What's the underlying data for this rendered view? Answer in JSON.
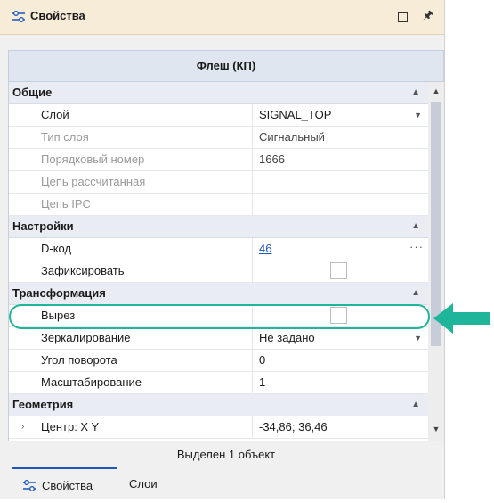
{
  "panel": {
    "title": "Свойства",
    "object_header": "Флеш (КП)",
    "status": "Выделен 1 объект"
  },
  "categories": [
    {
      "label": "Общие",
      "rows": [
        {
          "name": "Слой",
          "value": "SIGNAL_TOP",
          "kind": "dropdown",
          "disabled": false
        },
        {
          "name": "Тип слоя",
          "value": "Сигнальный",
          "kind": "text",
          "disabled": true
        },
        {
          "name": "Порядковый номер",
          "value": "1666",
          "kind": "text",
          "disabled": true
        },
        {
          "name": "Цепь рассчитанная",
          "value": "",
          "kind": "text",
          "disabled": true
        },
        {
          "name": "Цепь IPC",
          "value": "",
          "kind": "text",
          "disabled": true
        }
      ]
    },
    {
      "label": "Настройки",
      "rows": [
        {
          "name": "D-код",
          "value": "46",
          "kind": "link",
          "disabled": false
        },
        {
          "name": "Зафиксировать",
          "value": "",
          "kind": "checkbox",
          "checked": false,
          "disabled": false
        }
      ]
    },
    {
      "label": "Трансформация",
      "rows": [
        {
          "name": "Вырез",
          "value": "",
          "kind": "checkbox",
          "checked": false,
          "disabled": false,
          "highlighted": true
        },
        {
          "name": "Зеркалирование",
          "value": "Не задано",
          "kind": "dropdown",
          "disabled": false
        },
        {
          "name": "Угол поворота",
          "value": "0",
          "kind": "text",
          "disabled": false
        },
        {
          "name": "Масштабирование",
          "value": "1",
          "kind": "text",
          "disabled": false
        }
      ]
    },
    {
      "label": "Геометрия",
      "rows": [
        {
          "name": "Центр: X Y",
          "value": "-34,86; 36,46",
          "kind": "expandable",
          "disabled": false
        }
      ]
    }
  ],
  "tabs": [
    {
      "label": "Свойства",
      "active": true,
      "icon": "properties-icon"
    },
    {
      "label": "Слои",
      "active": false
    }
  ],
  "icons": {
    "title": "properties-icon",
    "maximize": "maximize-icon",
    "pin": "pin-icon",
    "collapse": "chevron-up-icon",
    "dropdown": "chevron-down-icon",
    "ellipsis": "ellipsis-icon",
    "expand": "chevron-right-icon"
  },
  "colors": {
    "titlebar_bg": "#f7ecd8",
    "header_bg": "#dfe6f0",
    "highlight": "#1fb59a",
    "link": "#1c57b9"
  }
}
